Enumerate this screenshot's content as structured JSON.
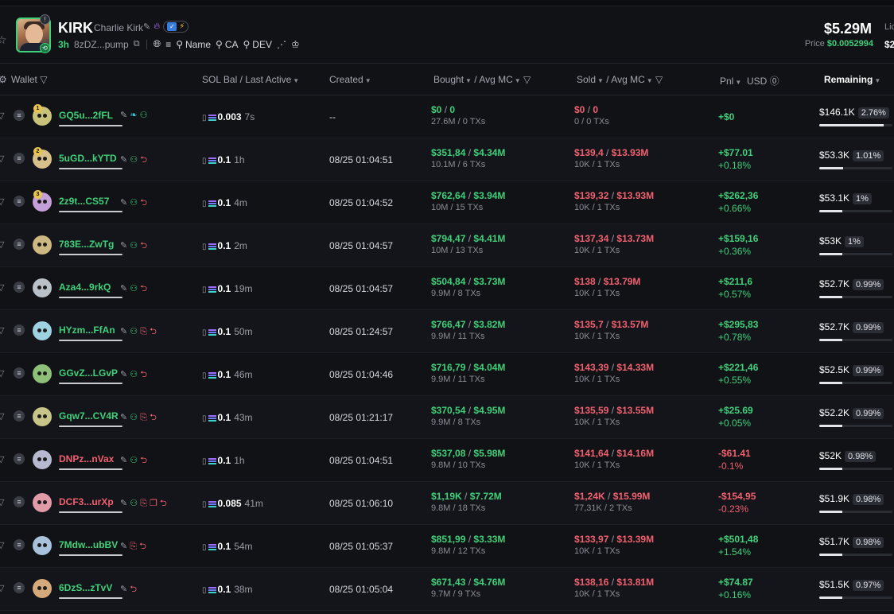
{
  "token": {
    "symbol": "KIRK",
    "name": "Charlie Kirk",
    "age": "3h",
    "address": "8zDZ...pump",
    "tools": [
      "Name",
      "CA",
      "DEV"
    ],
    "market_cap": "$5.29M",
    "price_label": "Price",
    "price": "$0.0052994",
    "liq_label": "Lic",
    "liq_value": "$2"
  },
  "columns": {
    "wallet": "Wallet",
    "sol_bal": "SOL Bal",
    "last_active": "Last Active",
    "created": "Created",
    "bought": "Bought",
    "avg_mc": "Avg MC",
    "sold": "Sold",
    "pnl": "Pnl",
    "usd": "USD",
    "remaining": "Remaining"
  },
  "rows": [
    {
      "rank": "1",
      "addr": "GQ5u...2fFL",
      "addr_color": "g",
      "av": "#c8c27a",
      "icons": [
        "pencil",
        "fish",
        "add"
      ],
      "sol": "0.003",
      "ago": "7s",
      "created": "--",
      "bought": "$0",
      "bought_mc": "0",
      "bought_vol": "27.6M / 0 TXs",
      "sold": "$0",
      "sold_mc": "0",
      "sold_vol": "0 / 0 TXs",
      "pnl": "+$0",
      "pnl_pct": "",
      "pnl_sign": "pos",
      "remaining": "$146.1K",
      "rem_pct": "2.76%",
      "rem_fill": 0.276
    },
    {
      "rank": "2",
      "addr": "5uGD...kYTD",
      "addr_color": "g",
      "av": "#d7c08a",
      "icons": [
        "pencil",
        "add",
        "exit"
      ],
      "sol": "0.1",
      "ago": "1h",
      "created": "08/25 01:04:51",
      "bought": "$351,84",
      "bought_mc": "$4.34M",
      "bought_vol": "10.1M / 6 TXs",
      "sold": "$139,4",
      "sold_mc": "$13.93M",
      "sold_vol": "10K / 1 TXs",
      "pnl": "+$77.01",
      "pnl_pct": "+0.18%",
      "pnl_sign": "pos",
      "remaining": "$53.3K",
      "rem_pct": "1.01%",
      "rem_fill": 0.101
    },
    {
      "rank": "3",
      "addr": "2z9t...CS57",
      "addr_color": "g",
      "av": "#c5a0d8",
      "icons": [
        "pencil",
        "add",
        "exit"
      ],
      "sol": "0.1",
      "ago": "4m",
      "created": "08/25 01:04:52",
      "bought": "$762,64",
      "bought_mc": "$3.94M",
      "bought_vol": "10M / 15 TXs",
      "sold": "$139,32",
      "sold_mc": "$13.93M",
      "sold_vol": "10K / 1 TXs",
      "pnl": "+$262,36",
      "pnl_pct": "+0.66%",
      "pnl_sign": "pos",
      "remaining": "$53.1K",
      "rem_pct": "1%",
      "rem_fill": 0.1
    },
    {
      "rank": "",
      "addr": "783E...ZwTg",
      "addr_color": "g",
      "av": "#cdb782",
      "icons": [
        "pencil",
        "add",
        "exit"
      ],
      "sol": "0.1",
      "ago": "2m",
      "created": "08/25 01:04:57",
      "bought": "$794,47",
      "bought_mc": "$4.41M",
      "bought_vol": "10M / 13 TXs",
      "sold": "$137,34",
      "sold_mc": "$13.73M",
      "sold_vol": "10K / 1 TXs",
      "pnl": "+$159,16",
      "pnl_pct": "+0.36%",
      "pnl_sign": "pos",
      "remaining": "$53K",
      "rem_pct": "1%",
      "rem_fill": 0.1
    },
    {
      "rank": "",
      "addr": "Aza4...9rkQ",
      "addr_color": "g",
      "av": "#b9c0c8",
      "icons": [
        "pencil",
        "add",
        "exit"
      ],
      "sol": "0.1",
      "ago": "19m",
      "created": "08/25 01:04:57",
      "bought": "$504,84",
      "bought_mc": "$3.73M",
      "bought_vol": "9.9M / 8 TXs",
      "sold": "$138",
      "sold_mc": "$13.79M",
      "sold_vol": "10K / 1 TXs",
      "pnl": "+$211,6",
      "pnl_pct": "+0.57%",
      "pnl_sign": "pos",
      "remaining": "$52.7K",
      "rem_pct": "0.99%",
      "rem_fill": 0.099
    },
    {
      "rank": "",
      "addr": "HYzm...FfAn",
      "addr_color": "g",
      "av": "#9fd2e0",
      "icons": [
        "pencil",
        "add",
        "copy",
        "exit"
      ],
      "sol": "0.1",
      "ago": "50m",
      "created": "08/25 01:24:57",
      "bought": "$766,47",
      "bought_mc": "$3.82M",
      "bought_vol": "9.9M / 11 TXs",
      "sold": "$135,7",
      "sold_mc": "$13.57M",
      "sold_vol": "10K / 1 TXs",
      "pnl": "+$295,83",
      "pnl_pct": "+0.78%",
      "pnl_sign": "pos",
      "remaining": "$52.7K",
      "rem_pct": "0.99%",
      "rem_fill": 0.099
    },
    {
      "rank": "",
      "addr": "GGvZ...LGvP",
      "addr_color": "g",
      "av": "#8ec07a",
      "icons": [
        "pencil",
        "add",
        "exit"
      ],
      "sol": "0.1",
      "ago": "46m",
      "created": "08/25 01:04:46",
      "bought": "$716,79",
      "bought_mc": "$4.04M",
      "bought_vol": "9.9M / 11 TXs",
      "sold": "$143,39",
      "sold_mc": "$14.33M",
      "sold_vol": "10K / 1 TXs",
      "pnl": "+$221,46",
      "pnl_pct": "+0.55%",
      "pnl_sign": "pos",
      "remaining": "$52.5K",
      "rem_pct": "0.99%",
      "rem_fill": 0.099
    },
    {
      "rank": "",
      "addr": "Gqw7...CV4R",
      "addr_color": "g",
      "av": "#c7c48a",
      "icons": [
        "pencil",
        "add",
        "copy",
        "exit"
      ],
      "sol": "0.1",
      "ago": "43m",
      "created": "08/25 01:21:17",
      "bought": "$370,54",
      "bought_mc": "$4.95M",
      "bought_vol": "9.9M / 8 TXs",
      "sold": "$135,59",
      "sold_mc": "$13.55M",
      "sold_vol": "10K / 1 TXs",
      "pnl": "+$25.69",
      "pnl_pct": "+0.05%",
      "pnl_sign": "pos",
      "remaining": "$52.2K",
      "rem_pct": "0.99%",
      "rem_fill": 0.099
    },
    {
      "rank": "",
      "addr": "DNPz...nVax",
      "addr_color": "r",
      "av": "#b7b9d0",
      "icons": [
        "pencil",
        "add",
        "exit"
      ],
      "sol": "0.1",
      "ago": "1h",
      "created": "08/25 01:04:51",
      "bought": "$537,08",
      "bought_mc": "$5.98M",
      "bought_vol": "9.8M / 10 TXs",
      "sold": "$141,64",
      "sold_mc": "$14.16M",
      "sold_vol": "10K / 1 TXs",
      "pnl": "-$61.41",
      "pnl_pct": "-0.1%",
      "pnl_sign": "neg",
      "remaining": "$52K",
      "rem_pct": "0.98%",
      "rem_fill": 0.098
    },
    {
      "rank": "",
      "addr": "DCF3...urXp",
      "addr_color": "r",
      "av": "#e09aa8",
      "icons": [
        "pencil",
        "add",
        "copy",
        "stack",
        "exit"
      ],
      "sol": "0.085",
      "ago": "41m",
      "created": "08/25 01:06:10",
      "bought": "$1,19K",
      "bought_mc": "$7.72M",
      "bought_vol": "9.8M / 18 TXs",
      "sold": "$1,24K",
      "sold_mc": "$15.99M",
      "sold_vol": "77,31K / 2 TXs",
      "pnl": "-$154,95",
      "pnl_pct": "-0.23%",
      "pnl_sign": "neg",
      "remaining": "$51.9K",
      "rem_pct": "0.98%",
      "rem_fill": 0.098
    },
    {
      "rank": "",
      "addr": "7Mdw...ubBV",
      "addr_color": "g",
      "av": "#a8c2dc",
      "icons": [
        "pencil",
        "copy",
        "exit"
      ],
      "sol": "0.1",
      "ago": "54m",
      "created": "08/25 01:05:37",
      "bought": "$851,99",
      "bought_mc": "$3.33M",
      "bought_vol": "9.8M / 12 TXs",
      "sold": "$133,97",
      "sold_mc": "$13.39M",
      "sold_vol": "10K / 1 TXs",
      "pnl": "+$501,48",
      "pnl_pct": "+1.54%",
      "pnl_sign": "pos",
      "remaining": "$51.7K",
      "rem_pct": "0.98%",
      "rem_fill": 0.098
    },
    {
      "rank": "",
      "addr": "6DzS...zTvV",
      "addr_color": "g",
      "av": "#d6a97a",
      "icons": [
        "pencil",
        "exit"
      ],
      "sol": "0.1",
      "ago": "38m",
      "created": "08/25 01:05:04",
      "bought": "$671,43",
      "bought_mc": "$4.76M",
      "bought_vol": "9.7M / 9 TXs",
      "sold": "$138,16",
      "sold_mc": "$13.81M",
      "sold_vol": "10K / 1 TXs",
      "pnl": "+$74.87",
      "pnl_pct": "+0.16%",
      "pnl_sign": "pos",
      "remaining": "$51.5K",
      "rem_pct": "0.97%",
      "rem_fill": 0.097
    }
  ]
}
